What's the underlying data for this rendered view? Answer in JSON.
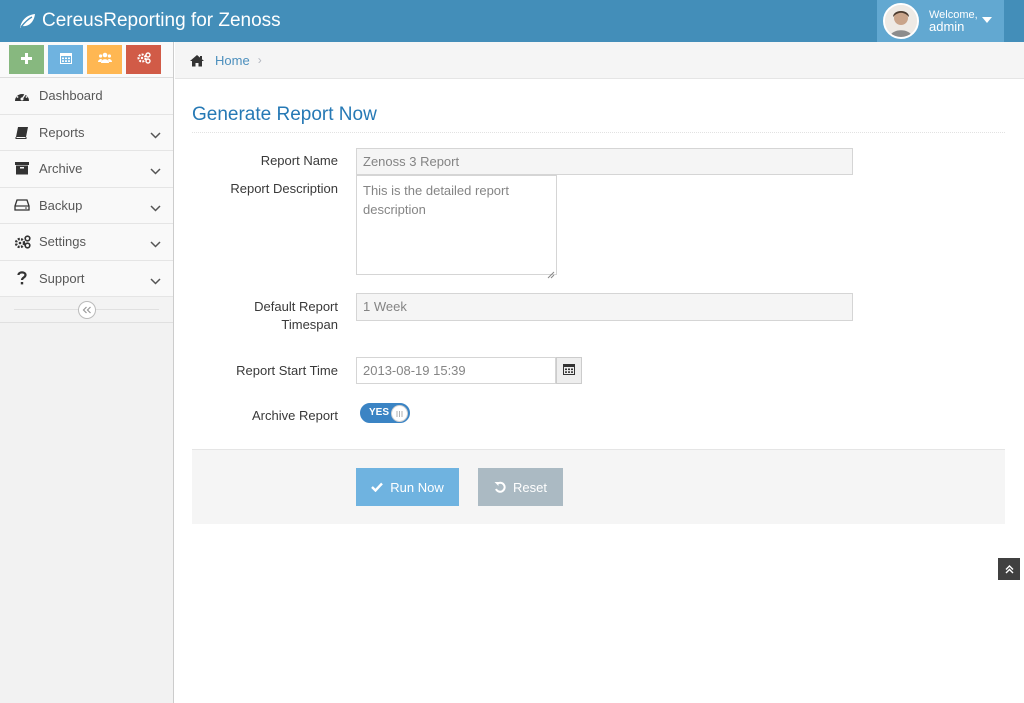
{
  "app": {
    "title": "CereusReporting for Zenoss"
  },
  "user": {
    "welcome": "Welcome,",
    "name": "admin"
  },
  "shortcuts": [
    {
      "icon": "plus-icon",
      "color": "#87b87f"
    },
    {
      "icon": "calendar-icon",
      "color": "#6fb3e0"
    },
    {
      "icon": "group-icon",
      "color": "#ffb752"
    },
    {
      "icon": "cogs-icon",
      "color": "#d15b47"
    }
  ],
  "sidebar": {
    "items": [
      {
        "label": "Dashboard",
        "icon": "dashboard-icon"
      },
      {
        "label": "Reports",
        "icon": "book-icon"
      },
      {
        "label": "Archive",
        "icon": "archive-icon"
      },
      {
        "label": "Backup",
        "icon": "hdd-icon"
      },
      {
        "label": "Settings",
        "icon": "cogs-icon"
      },
      {
        "label": "Support",
        "icon": "question-icon"
      }
    ]
  },
  "breadcrumb": {
    "home": "Home"
  },
  "page": {
    "title": "Generate Report Now"
  },
  "form": {
    "report_name_label": "Report Name",
    "report_name_value": "Zenoss 3 Report",
    "description_label": "Report Description",
    "description_value": "This is the detailed report description",
    "timespan_label_line1": "Default Report",
    "timespan_label_line2": "Timespan",
    "timespan_value": "1 Week",
    "start_time_label": "Report Start Time",
    "start_time_value": "2013-08-19 15:39",
    "archive_label": "Archive Report",
    "archive_toggle": "YES"
  },
  "actions": {
    "run_label": "Run Now",
    "reset_label": "Reset"
  },
  "colors": {
    "navbar": "#438eb9",
    "title": "#2679b5",
    "run_button": "#6fb3e0",
    "reset_button": "#abbac3"
  }
}
